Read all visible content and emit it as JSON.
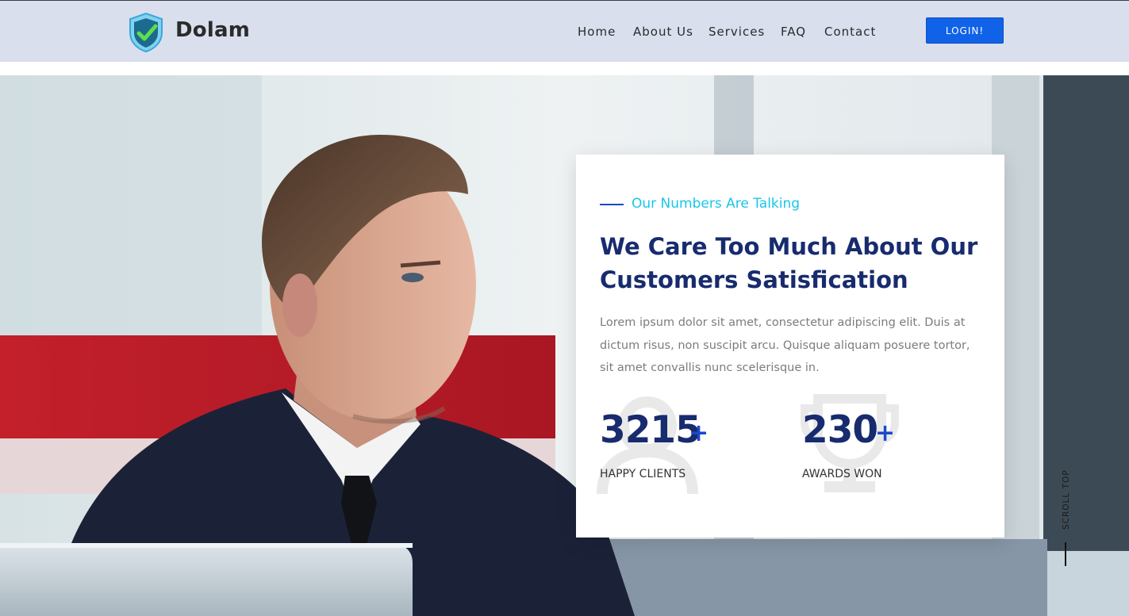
{
  "header": {
    "brand": "Dolam",
    "nav": [
      "Home",
      "About Us",
      "Services",
      "FAQ",
      "Contact"
    ],
    "login_label": "LOGIN!"
  },
  "hero": {
    "image_subject": "business-man-photo"
  },
  "card": {
    "eyebrow": "Our Numbers Are Talking",
    "title_line1": "We Care Too Much About Our",
    "title_line2": "Customers Satisfication",
    "paragraph": "Lorem ipsum dolor sit amet, consectetur adipiscing elit. Duis at dictum risus, non suscipit arcu. Quisque aliquam posuere tortor, sit amet convallis nunc scelerisque in.",
    "stats": [
      {
        "value": "3215",
        "suffix": "+",
        "label": "HAPPY CLIENTS",
        "icon": "user-icon"
      },
      {
        "value": "230",
        "suffix": "+",
        "label": "AWARDS WON",
        "icon": "trophy-icon"
      }
    ]
  },
  "scroll_top": {
    "label": "SCROLL TOP"
  },
  "colors": {
    "header_bg": "#dadfee",
    "accent_blue": "#1063e8",
    "heading_navy": "#172b6e",
    "eyebrow_cyan": "#19c6e8"
  }
}
